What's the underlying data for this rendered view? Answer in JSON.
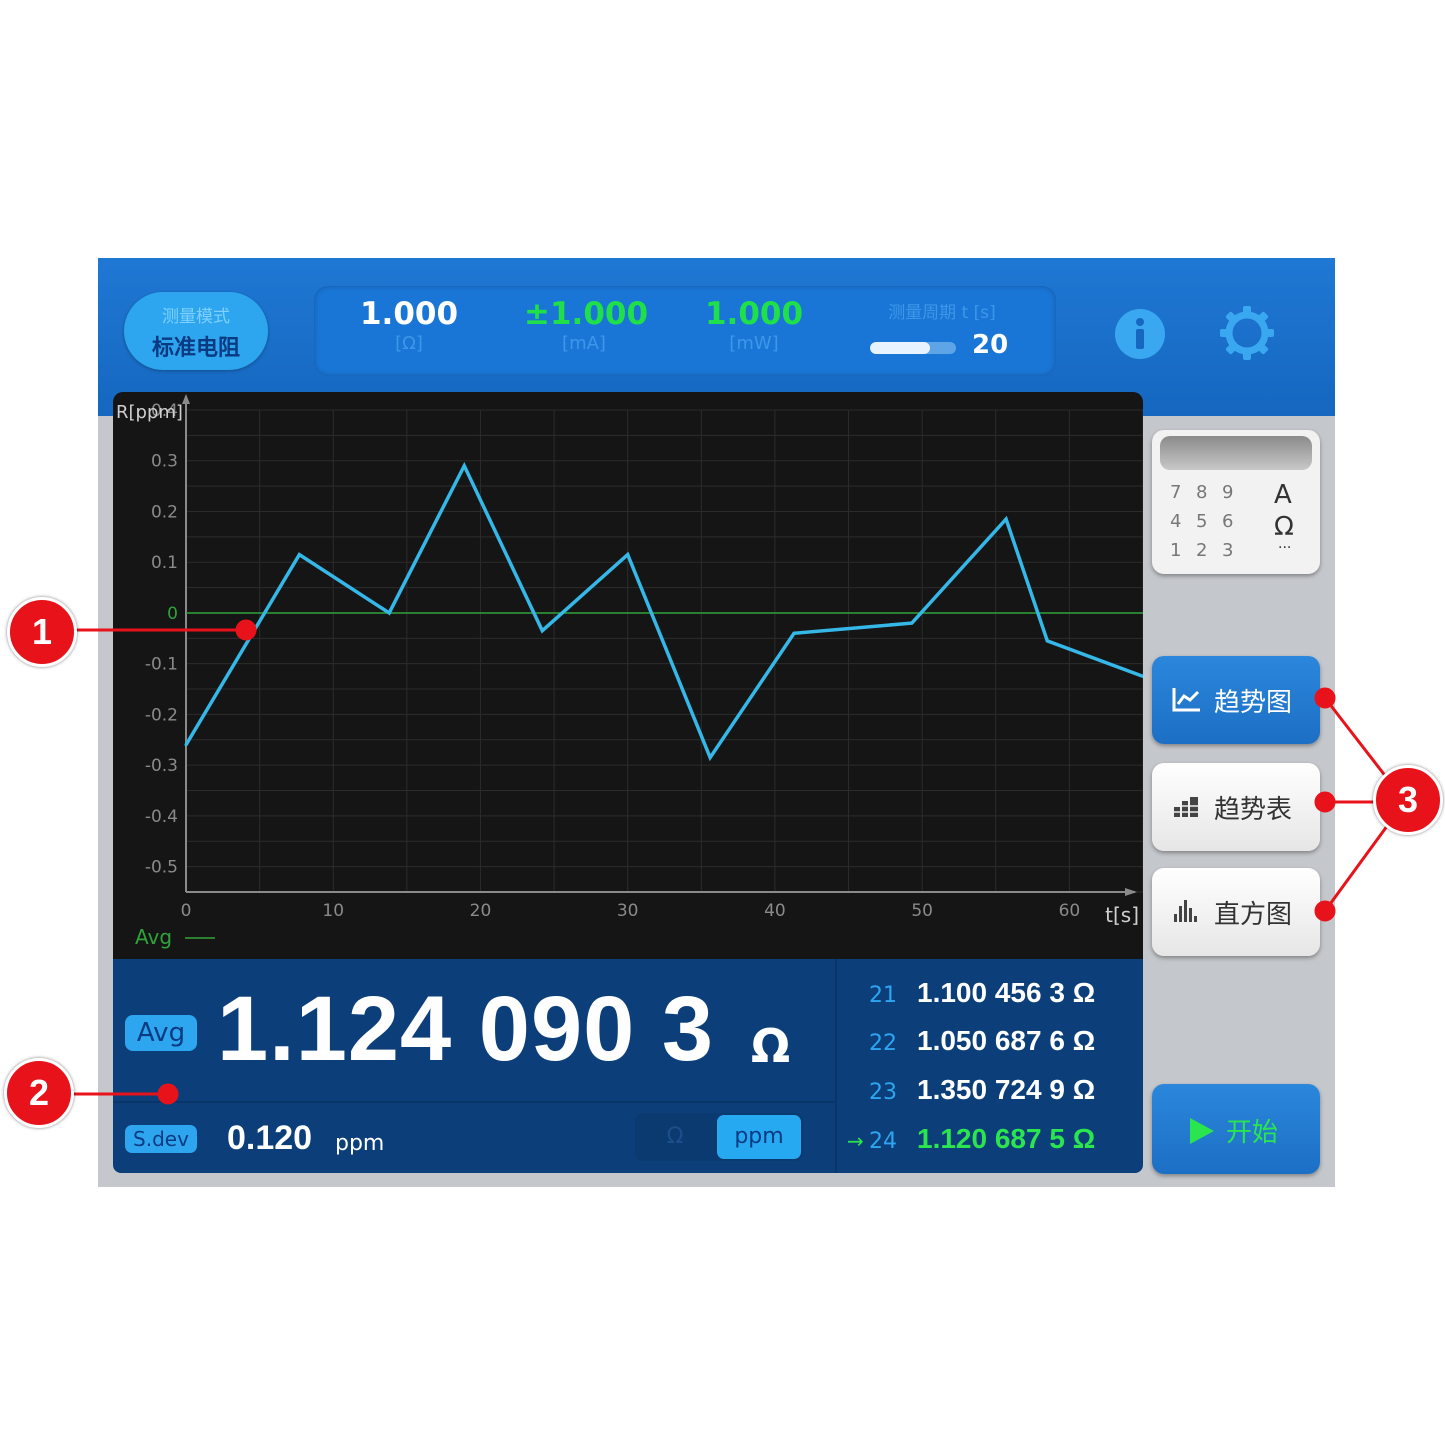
{
  "header": {
    "mode_label": "测量模式",
    "mode_value": "标准电阻",
    "resistance": {
      "value": "1.000",
      "unit": "[Ω]"
    },
    "current": {
      "value": "±1.000",
      "unit": "[mA]"
    },
    "power": {
      "value": "1.000",
      "unit": "[mW]"
    },
    "cycle": {
      "label": "测量周期 t [s]",
      "value": "20",
      "progress": 0.7
    },
    "info_icon": "info-icon",
    "settings_icon": "gear-icon"
  },
  "chart_data": {
    "type": "line",
    "ylabel": "R[ppm]",
    "xlabel": "t[s]",
    "ylim": [
      -0.55,
      0.4
    ],
    "xlim": [
      0,
      65
    ],
    "yticks": [
      "0.4",
      "0.3",
      "0.2",
      "0.1",
      "0",
      "-0.1",
      "-0.2",
      "-0.3",
      "-0.4",
      "-0.5"
    ],
    "ytick_values": [
      0.4,
      0.3,
      0.2,
      0.1,
      0,
      -0.1,
      -0.2,
      -0.3,
      -0.4,
      -0.5
    ],
    "xticks": [
      "0",
      "10",
      "20",
      "30",
      "40",
      "50",
      "60"
    ],
    "xtick_values": [
      0,
      10,
      20,
      30,
      40,
      50,
      60
    ],
    "legend": "Avg",
    "avg_value": 0,
    "grid": true,
    "series": [
      {
        "x": [
          0,
          7.7,
          13.8,
          18.9,
          24.2,
          30,
          35.6,
          41.3,
          49.3,
          55.7,
          58.5,
          65
        ],
        "values": [
          -0.26,
          0.115,
          0.0,
          0.29,
          -0.035,
          0.115,
          -0.285,
          -0.04,
          -0.02,
          0.185,
          -0.055,
          -0.125
        ],
        "color": "#35b8e8"
      }
    ],
    "avg_color": "#2fa33a"
  },
  "result": {
    "avg_badge": "Avg",
    "avg_value": "1.124 090 3",
    "avg_unit": "Ω",
    "sdev_badge": "S.dev",
    "sdev_value": "0.120",
    "sdev_unit": "ppm",
    "unit_options": [
      "Ω",
      "ppm"
    ],
    "unit_selected": "ppm"
  },
  "results_list": [
    {
      "index": "21",
      "value": "1.100 456 3 Ω",
      "current": false
    },
    {
      "index": "22",
      "value": "1.050 687 6 Ω",
      "current": false
    },
    {
      "index": "23",
      "value": "1.350 724 9 Ω",
      "current": false
    },
    {
      "index": "24",
      "value": "1.120 687 5 Ω",
      "current": true,
      "arrow": "→"
    }
  ],
  "keypad": {
    "keys": [
      "7",
      "8",
      "9",
      "4",
      "5",
      "6",
      "1",
      "2",
      "3"
    ],
    "units": [
      "A",
      "Ω",
      "..."
    ]
  },
  "side_buttons": {
    "trend_chart": "趋势图",
    "trend_table": "趋势表",
    "histogram": "直方图",
    "start": "开始"
  },
  "annotations": [
    "1",
    "2",
    "3"
  ],
  "colors": {
    "header_blue": "#1f78d4",
    "accent_green": "#2be54f",
    "callout_red": "#e8121a"
  }
}
